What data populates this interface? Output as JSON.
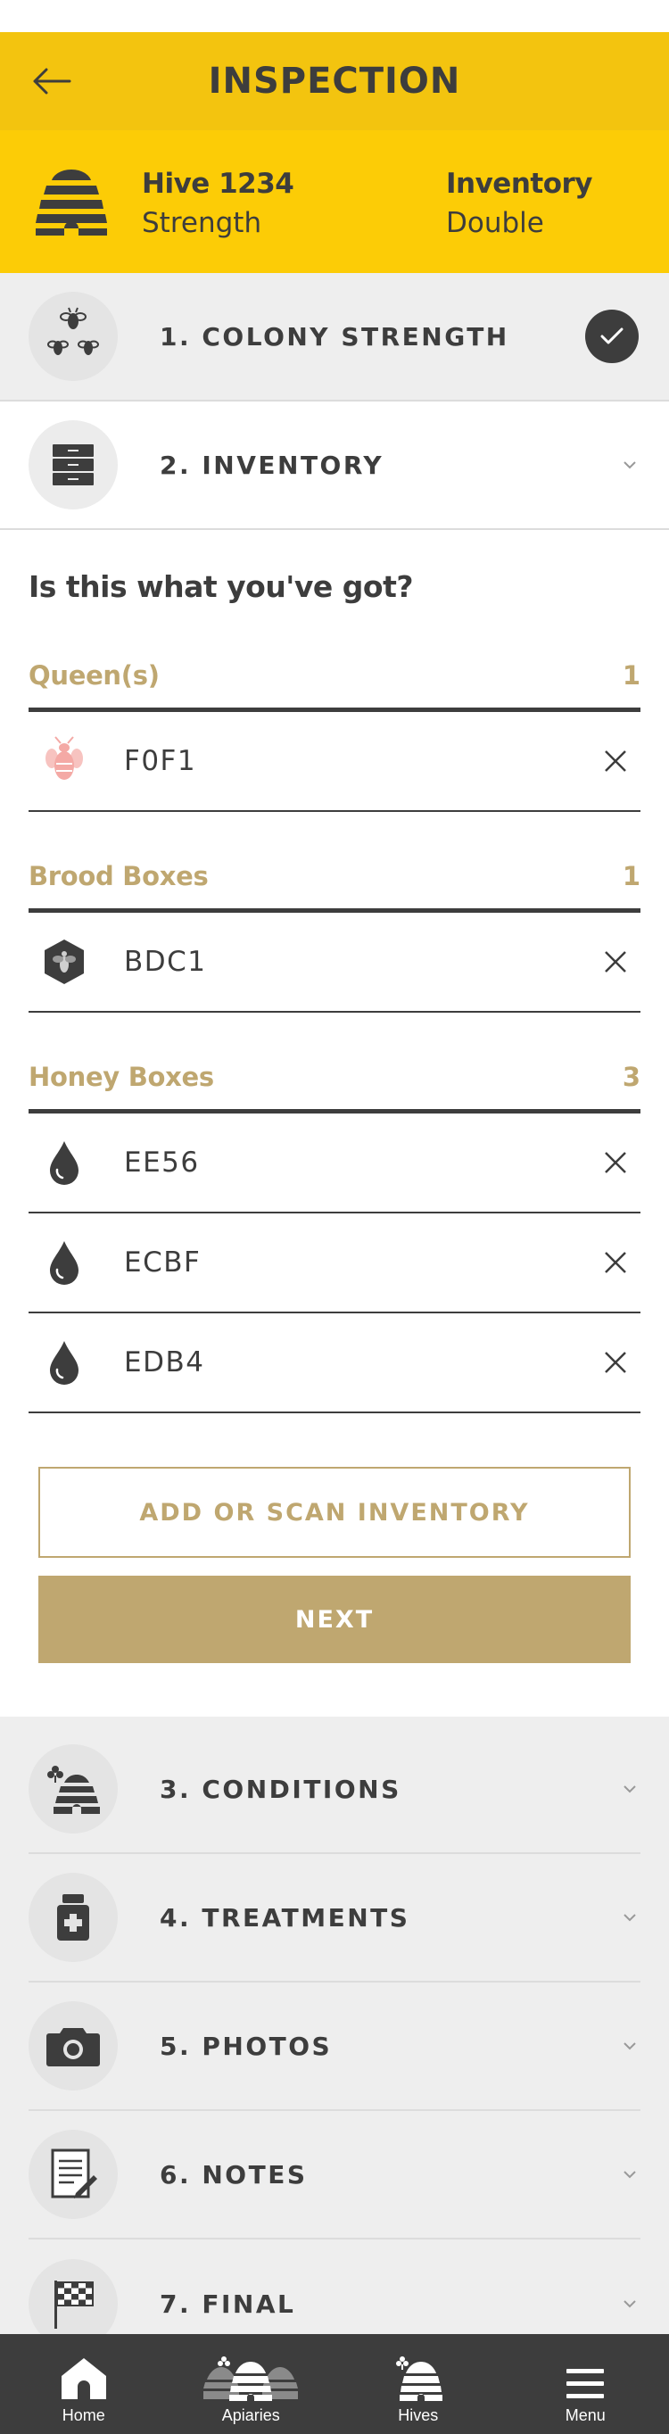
{
  "header": {
    "title": "INSPECTION",
    "back_icon": "arrow-left-icon"
  },
  "hive": {
    "name_label": "Hive 1234",
    "name_sub": "Strength",
    "inv_label": "Inventory",
    "inv_sub": "Double"
  },
  "sections": [
    {
      "title": "1. COLONY STRENGTH",
      "icon": "bees-icon",
      "completed": true
    },
    {
      "title": "2. INVENTORY",
      "icon": "dresser-icon",
      "expanded": true
    },
    {
      "title": "3. CONDITIONS",
      "icon": "hive-clover-icon"
    },
    {
      "title": "4. TREATMENTS",
      "icon": "medicine-bottle-icon"
    },
    {
      "title": "5. PHOTOS",
      "icon": "camera-icon"
    },
    {
      "title": "6. NOTES",
      "icon": "notepad-icon"
    },
    {
      "title": "7. FINAL",
      "icon": "checkered-flag-icon"
    }
  ],
  "inventory": {
    "question": "Is this what you've got?",
    "groups": [
      {
        "name": "Queen(s)",
        "count": "1",
        "items": [
          {
            "code": "F0F1",
            "icon": "queen-bee-icon"
          }
        ]
      },
      {
        "name": "Brood Boxes",
        "count": "1",
        "items": [
          {
            "code": "BDC1",
            "icon": "brood-hexagon-icon"
          }
        ]
      },
      {
        "name": "Honey Boxes",
        "count": "3",
        "items": [
          {
            "code": "EE56",
            "icon": "honey-drop-icon"
          },
          {
            "code": "ECBF",
            "icon": "honey-drop-icon"
          },
          {
            "code": "EDB4",
            "icon": "honey-drop-icon"
          }
        ]
      }
    ],
    "add_button": "ADD OR SCAN INVENTORY",
    "next_button": "NEXT"
  },
  "tabbar": [
    {
      "label": "Home",
      "icon": "home-icon"
    },
    {
      "label": "Apiaries",
      "icon": "apiaries-icon"
    },
    {
      "label": "Hives",
      "icon": "hive-icon"
    },
    {
      "label": "Menu",
      "icon": "hamburger-menu-icon"
    }
  ],
  "colors": {
    "yellow_header": "#f3c40f",
    "yellow_info": "#fccc06",
    "gold": "#bfa770",
    "dark": "#3d3d3d",
    "queen_pink": "#f4a9a5"
  }
}
